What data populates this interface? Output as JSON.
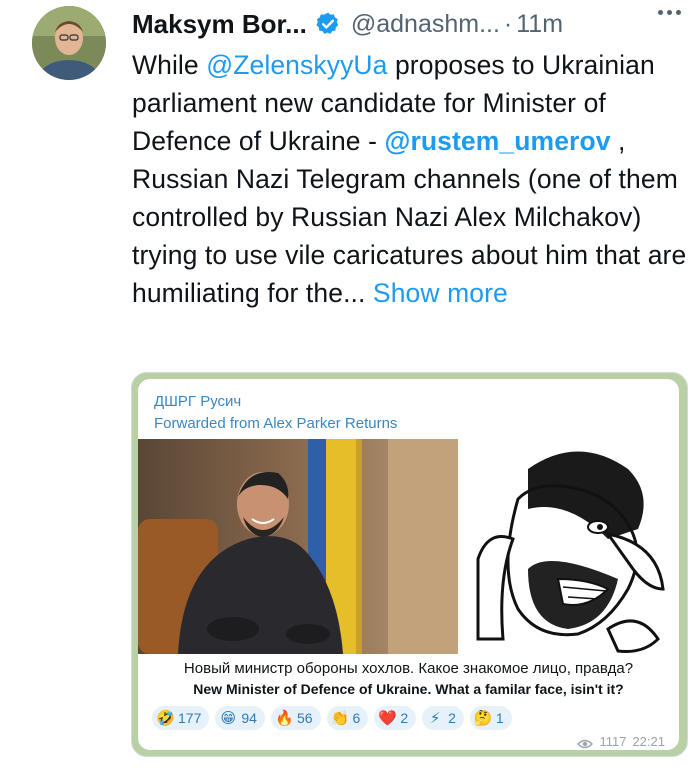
{
  "tweet": {
    "author_name": "Maksym Bor...",
    "author_handle": "@adnashm...",
    "separator": "·",
    "time": "11m",
    "text_parts": {
      "p1": "While ",
      "mention1": "@ZelenskyyUa",
      "p2": " proposes to Ukrainian parliament new candidate for Minister of Defence of Ukraine - ",
      "mention2": "@rustem_umerov",
      "p3": " , Russian Nazi Telegram channels (one of them controlled by Russian Nazi Alex Milchakov)  trying to use vile caricatures about him that are humiliating for the... ",
      "show_more": "Show more"
    }
  },
  "telegram": {
    "channel": "ДШРГ Русич",
    "forwarded": "Forwarded from Alex Parker Returns",
    "caption_ru": "Новый министр обороны хохлов. Какое знакомое лицо, правда?",
    "caption_en": "New Minister of Defence of Ukraine. What a familar face, isin't it?",
    "reactions": [
      {
        "emoji": "🤣",
        "count": "177"
      },
      {
        "emoji": "😁",
        "count": "94"
      },
      {
        "emoji": "🔥",
        "count": "56"
      },
      {
        "emoji": "👏",
        "count": "6"
      },
      {
        "emoji": "❤️",
        "count": "2"
      },
      {
        "emoji": "⚡",
        "count": "2"
      },
      {
        "emoji": "🤔",
        "count": "1"
      }
    ],
    "views": "1117",
    "time": "22:21"
  },
  "colors": {
    "link": "#1d9bf0",
    "telegram_link": "#3a87c2",
    "verified": "#1d9bf0",
    "muted": "#536471"
  }
}
